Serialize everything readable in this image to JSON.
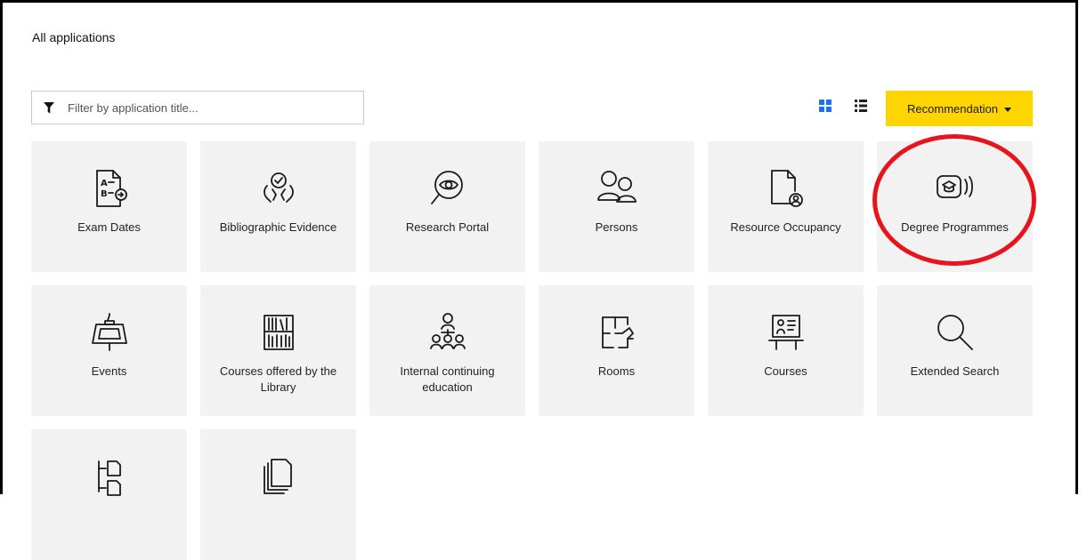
{
  "page": {
    "title": "All applications"
  },
  "filter": {
    "placeholder": "Filter by application title..."
  },
  "view": {
    "grid_active": true
  },
  "sort": {
    "label": "Recommendation"
  },
  "colors": {
    "accent": "#ffd500",
    "tile_bg": "#f2f2f2",
    "active_view": "#1a73e8",
    "highlight": "#e8141b"
  },
  "tiles": [
    {
      "label": "Exam Dates",
      "icon": "exam-dates-icon"
    },
    {
      "label": "Bibliographic Evidence",
      "icon": "bibliographic-evidence-icon"
    },
    {
      "label": "Research Portal",
      "icon": "research-portal-icon"
    },
    {
      "label": "Persons",
      "icon": "persons-icon"
    },
    {
      "label": "Resource Occupancy",
      "icon": "resource-occupancy-icon"
    },
    {
      "label": "Degree Programmes",
      "icon": "degree-programmes-icon"
    },
    {
      "label": "Events",
      "icon": "events-icon"
    },
    {
      "label": "Courses offered by the Library",
      "icon": "library-courses-icon"
    },
    {
      "label": "Internal continuing education",
      "icon": "continuing-education-icon"
    },
    {
      "label": "Rooms",
      "icon": "rooms-icon"
    },
    {
      "label": "Courses",
      "icon": "courses-icon"
    },
    {
      "label": "Extended Search",
      "icon": "extended-search-icon"
    },
    {
      "label": "",
      "icon": "document-tree-icon"
    },
    {
      "label": "",
      "icon": "documents-stack-icon"
    }
  ]
}
